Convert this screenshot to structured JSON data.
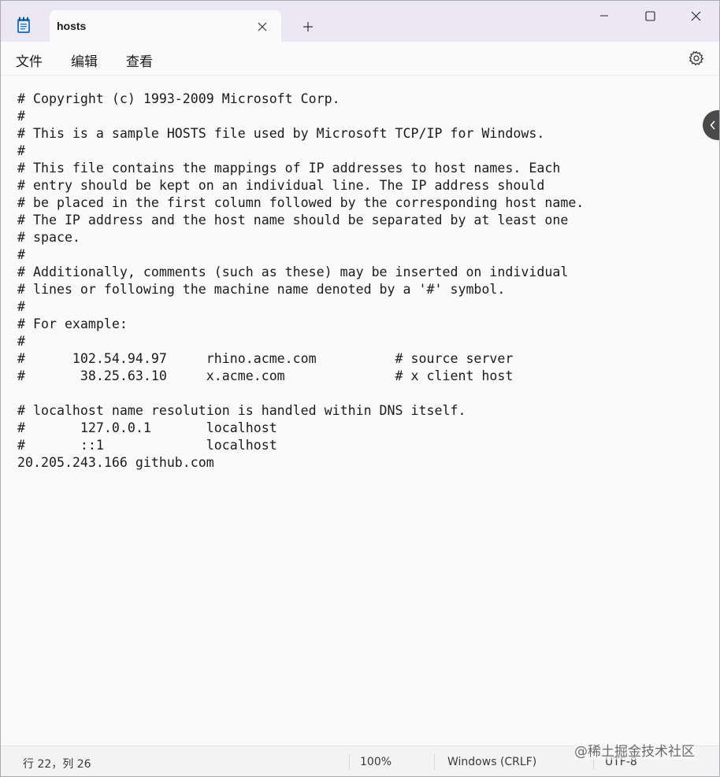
{
  "tab": {
    "title": "hosts"
  },
  "menu": {
    "file": "文件",
    "edit": "编辑",
    "view": "查看"
  },
  "editor": {
    "lines": [
      "# Copyright (c) 1993-2009 Microsoft Corp.",
      "#",
      "# This is a sample HOSTS file used by Microsoft TCP/IP for Windows.",
      "#",
      "# This file contains the mappings of IP addresses to host names. Each",
      "# entry should be kept on an individual line. The IP address should",
      "# be placed in the first column followed by the corresponding host name.",
      "# The IP address and the host name should be separated by at least one",
      "# space.",
      "#",
      "# Additionally, comments (such as these) may be inserted on individual",
      "# lines or following the machine name denoted by a '#' symbol.",
      "#",
      "# For example:",
      "#",
      "#      102.54.94.97     rhino.acme.com          # source server",
      "#       38.25.63.10     x.acme.com              # x client host",
      "",
      "# localhost name resolution is handled within DNS itself.",
      "#       127.0.0.1       localhost",
      "#       ::1             localhost",
      "20.205.243.166 github.com"
    ]
  },
  "status": {
    "position": "行 22，列 26",
    "zoom": "100%",
    "line_ending": "Windows (CRLF)",
    "encoding": "UTF-8"
  },
  "watermark": "@稀土掘金技术社区",
  "icons": {
    "app": "notepad-icon",
    "close_tab": "close-icon",
    "new_tab": "plus-icon",
    "minimize": "minimize-icon",
    "maximize": "maximize-icon",
    "close_window": "close-icon",
    "settings": "gear-icon",
    "side": "chevron-left-icon"
  },
  "colors": {
    "titlebar": "#ebe8f4",
    "editor_bg": "#fafafa",
    "accent": "#2b78c5"
  }
}
